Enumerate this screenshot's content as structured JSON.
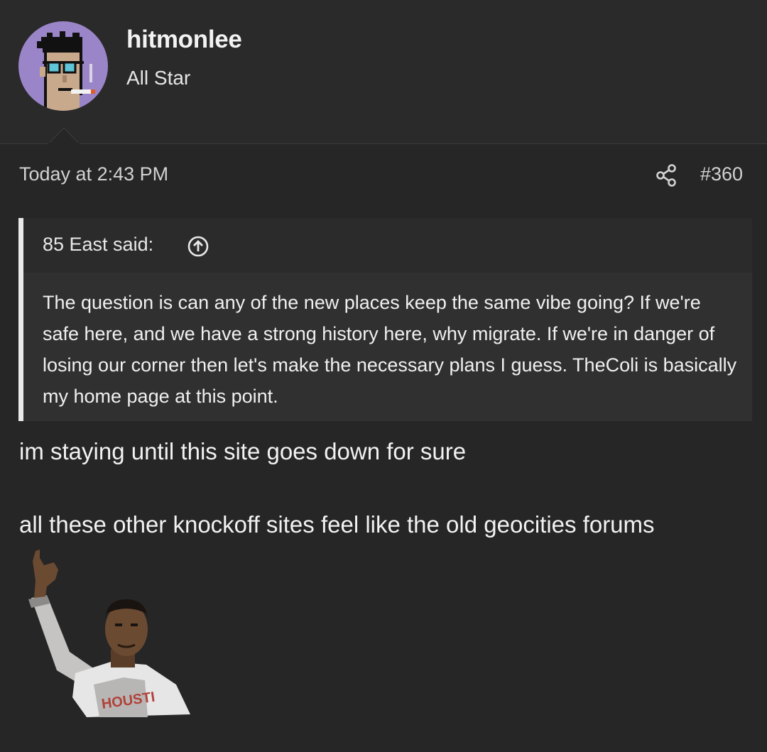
{
  "user": {
    "name": "hitmonlee",
    "title": "All Star",
    "avatar_icon": "pixel-punk-avatar",
    "avatar_color": "#9b85c9"
  },
  "post": {
    "date": "Today at 2:43 PM",
    "number": "#360",
    "share_icon": "share-icon"
  },
  "quote": {
    "attribution": "85 East said:",
    "jump_icon": "arrow-up-circle-icon",
    "text": "The question is can any of the new places keep the same vibe going? If we're safe here, and we have a strong history here, why migrate. If we're in danger of losing our corner then let's make the necessary plans I guess. TheColi is basically my home page at this point."
  },
  "message": {
    "line1": "im staying until this site goes down for sure",
    "line2": "all these other knockoff sites feel like the old geocities forums"
  },
  "reaction": {
    "icon": "thumbs-up-man-image",
    "jersey_text": "HOUSTI"
  }
}
